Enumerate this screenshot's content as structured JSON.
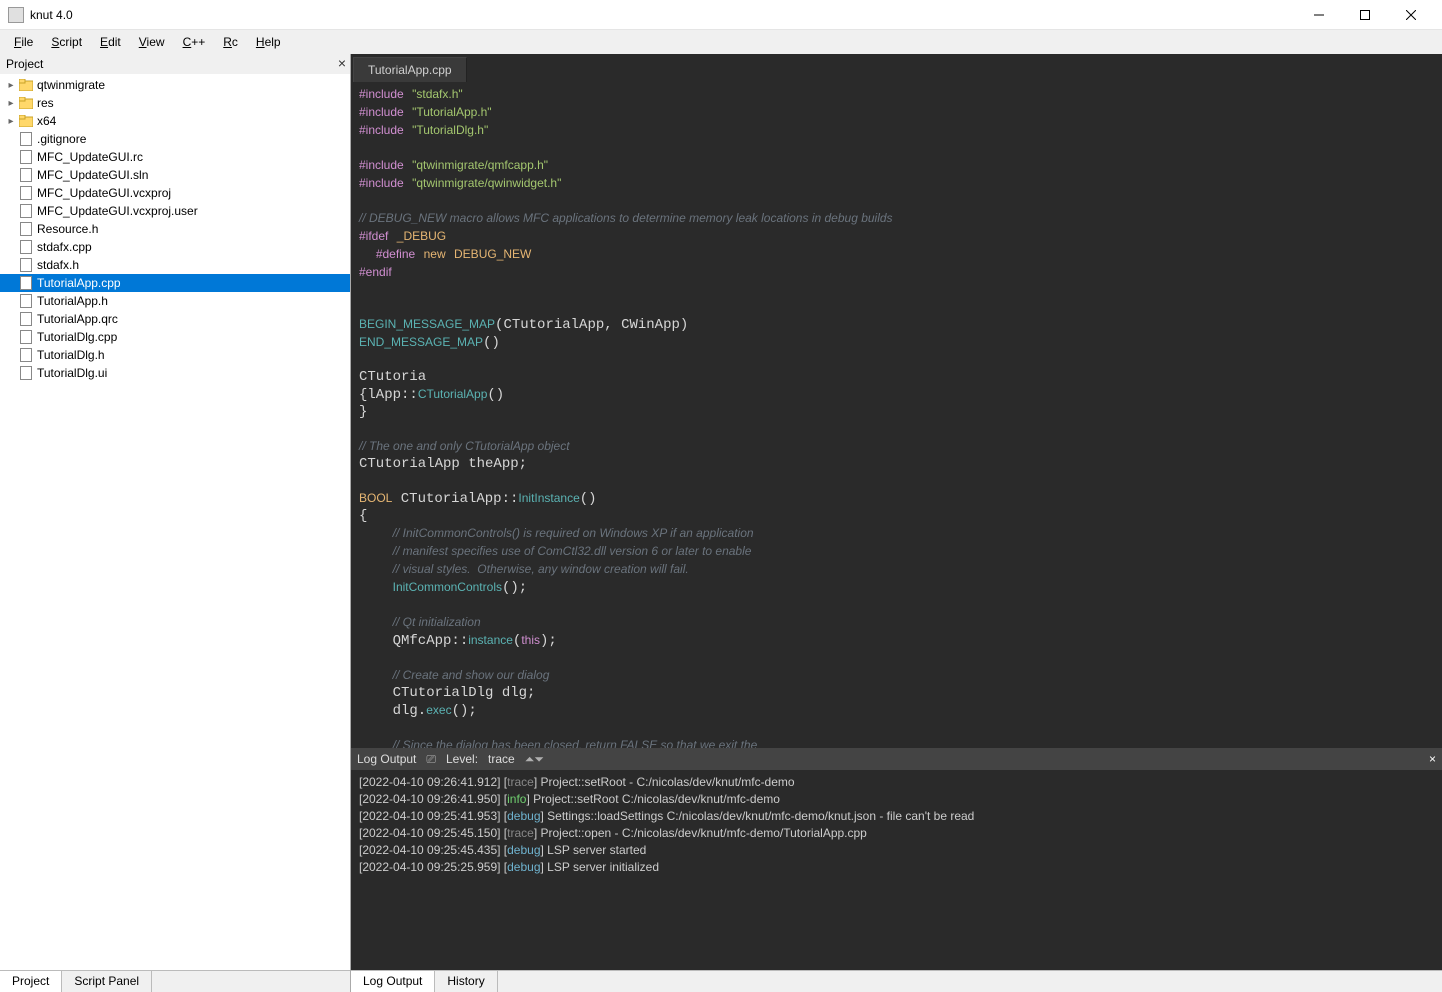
{
  "window": {
    "title": "knut 4.0"
  },
  "menu": [
    "File",
    "Script",
    "Edit",
    "View",
    "C++",
    "Rc",
    "Help"
  ],
  "left": {
    "header": "Project",
    "tabs": [
      "Project",
      "Script Panel"
    ],
    "active_tab": 0,
    "tree": [
      {
        "indent": 0,
        "tw": "▸",
        "icon": "folder",
        "label": "qtwinmigrate"
      },
      {
        "indent": 0,
        "tw": "▸",
        "icon": "folder",
        "label": "res"
      },
      {
        "indent": 0,
        "tw": "▸",
        "icon": "folder",
        "label": "x64"
      },
      {
        "indent": 0,
        "tw": "",
        "icon": "file",
        "label": ".gitignore"
      },
      {
        "indent": 0,
        "tw": "",
        "icon": "rc",
        "label": "MFC_UpdateGUI.rc"
      },
      {
        "indent": 0,
        "tw": "",
        "icon": "sln",
        "label": "MFC_UpdateGUI.sln"
      },
      {
        "indent": 0,
        "tw": "",
        "icon": "vcx",
        "label": "MFC_UpdateGUI.vcxproj"
      },
      {
        "indent": 0,
        "tw": "",
        "icon": "vcx",
        "label": "MFC_UpdateGUI.vcxproj.user"
      },
      {
        "indent": 0,
        "tw": "",
        "icon": "h",
        "label": "Resource.h"
      },
      {
        "indent": 0,
        "tw": "",
        "icon": "cpp",
        "label": "stdafx.cpp"
      },
      {
        "indent": 0,
        "tw": "",
        "icon": "h",
        "label": "stdafx.h"
      },
      {
        "indent": 0,
        "tw": "",
        "icon": "cpp",
        "label": "TutorialApp.cpp",
        "selected": true
      },
      {
        "indent": 0,
        "tw": "",
        "icon": "h",
        "label": "TutorialApp.h"
      },
      {
        "indent": 0,
        "tw": "",
        "icon": "file",
        "label": "TutorialApp.qrc"
      },
      {
        "indent": 0,
        "tw": "",
        "icon": "cpp",
        "label": "TutorialDlg.cpp"
      },
      {
        "indent": 0,
        "tw": "",
        "icon": "h",
        "label": "TutorialDlg.h"
      },
      {
        "indent": 0,
        "tw": "",
        "icon": "file",
        "label": "TutorialDlg.ui"
      }
    ]
  },
  "editor": {
    "tab": "TutorialApp.cpp",
    "code_html": "<span class=\"kw\">#include</span> <span class=\"str\">\"stdafx.h\"</span>\n<span class=\"kw\">#include</span> <span class=\"str\">\"TutorialApp.h\"</span>\n<span class=\"kw\">#include</span> <span class=\"str\">\"TutorialDlg.h\"</span>\n\n<span class=\"kw\">#include</span> <span class=\"str\">\"qtwinmigrate/qmfcapp.h\"</span>\n<span class=\"kw\">#include</span> <span class=\"str\">\"qtwinmigrate/qwinwidget.h\"</span>\n\n<span class=\"cm\">// DEBUG_NEW macro allows MFC applications to determine memory leak locations in debug builds</span>\n<span class=\"kw\">#ifdef</span> <span class=\"ty\">_DEBUG</span>\n  <span class=\"kw\">#define</span> <span class=\"ty\">new</span> <span class=\"ty\">DEBUG_NEW</span>\n<span class=\"kw\">#endif</span>\n\n\n<span class=\"fn\">BEGIN_MESSAGE_MAP</span>(CTutorialApp, CWinApp)\n<span class=\"fn\">END_MESSAGE_MAP</span>()\n\nCTutoria\n{lApp::<span class=\"fn\">CTutorialApp</span>()\n}\n\n<span class=\"cm\">// The one and only CTutorialApp object</span>\nCTutorialApp theApp;\n\n<span class=\"ty\">BOOL</span> CTutorialApp::<span class=\"fn\">InitInstance</span>()\n{\n    <span class=\"cm\">// InitCommonControls() is required on Windows XP if an application</span>\n    <span class=\"cm\">// manifest specifies use of ComCtl32.dll version 6 or later to enable</span>\n    <span class=\"cm\">// visual styles.  Otherwise, any window creation will fail.</span>\n    <span class=\"fn\">InitCommonControls</span>();\n\n    <span class=\"cm\">// Qt initialization</span>\n    QMfcApp::<span class=\"fn\">instance</span>(<span class=\"lit\">this</span>);\n\n    <span class=\"cm\">// Create and show our dialog</span>\n    CTutorialDlg dlg;\n    dlg.<span class=\"fn\">exec</span>();\n\n    <span class=\"cm\">// Since the dialog has been closed, return FALSE so that we exit the</span>\n    <span class=\"cm\">//  application, rather than start the application's message pump.</span>\n    <span class=\"kw\">return</span> <span class=\"lit\">FALSE</span>;"
  },
  "logbar": {
    "title": "Log Output",
    "level_label": "Level:",
    "level_value": "trace"
  },
  "log_lines": [
    {
      "ts": "[2022-04-10 09:26:41.912]",
      "lvl": "trace",
      "msg": "Project::setRoot - C:/nicolas/dev/knut/mfc-demo"
    },
    {
      "ts": "[2022-04-10 09:26:41.950]",
      "lvl": "info",
      "msg": "Project::setRoot C:/nicolas/dev/knut/mfc-demo"
    },
    {
      "ts": "[2022-04-10 09:25:41.953]",
      "lvl": "debug",
      "msg": "Settings::loadSettings C:/nicolas/dev/knut/mfc-demo/knut.json - file can't be read"
    },
    {
      "ts": "[2022-04-10 09:25:45.150]",
      "lvl": "trace",
      "msg": "Project::open - C:/nicolas/dev/knut/mfc-demo/TutorialApp.cpp"
    },
    {
      "ts": "[2022-04-10 09:25:45.435]",
      "lvl": "debug",
      "msg": "LSP server started"
    },
    {
      "ts": "[2022-04-10 09:25:25.959]",
      "lvl": "debug",
      "msg": "LSP server initialized"
    }
  ],
  "bottom_tabs": [
    "Log Output",
    "History"
  ],
  "bottom_active": 0
}
